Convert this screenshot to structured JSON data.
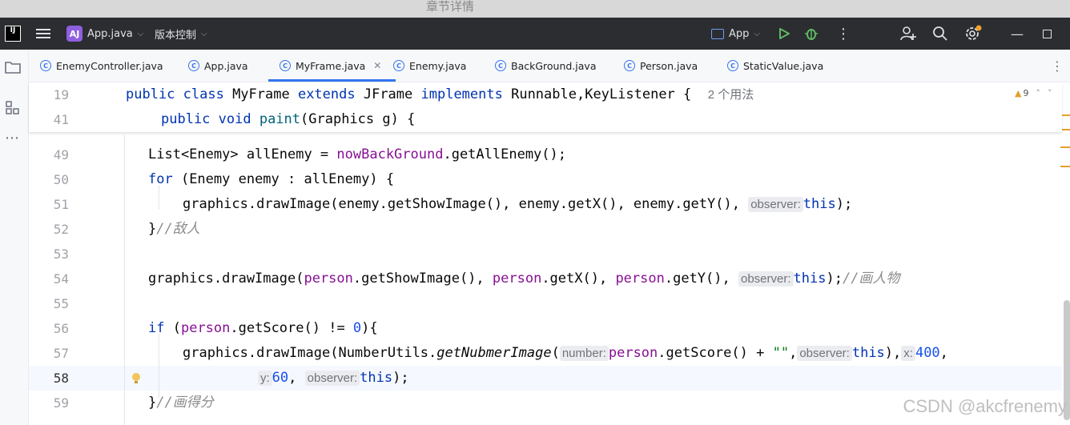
{
  "window": {
    "title": "章节详情"
  },
  "toolbar": {
    "project_badge": "AJ",
    "project_name": "App.java",
    "vcs_label": "版本控制",
    "run_config": "App"
  },
  "tabs": [
    {
      "label": "EnemyController.java",
      "active": false
    },
    {
      "label": "App.java",
      "active": false
    },
    {
      "label": "MyFrame.java",
      "active": true
    },
    {
      "label": "Enemy.java",
      "active": false
    },
    {
      "label": "BackGround.java",
      "active": false
    },
    {
      "label": "Person.java",
      "active": false
    },
    {
      "label": "StaticValue.java",
      "active": false
    }
  ],
  "inspection": {
    "warnings": "9"
  },
  "editor": {
    "sticky": [
      {
        "num": "19",
        "a": "public class ",
        "b": "MyFrame ",
        "c": "extends ",
        "d": "JFrame ",
        "e": "implements ",
        "f": "Runnable,KeyListener {",
        "hint": "2 个用法"
      },
      {
        "num": "41",
        "a": "public void ",
        "b": "paint",
        "c": "(Graphics g) {"
      }
    ],
    "lines": [
      {
        "num": "49"
      },
      {
        "num": "50"
      },
      {
        "num": "51"
      },
      {
        "num": "52"
      },
      {
        "num": "53"
      },
      {
        "num": "54"
      },
      {
        "num": "55"
      },
      {
        "num": "56"
      },
      {
        "num": "57"
      },
      {
        "num": "58"
      },
      {
        "num": "59"
      }
    ],
    "l49": {
      "a": "List<Enemy> allEnemy = ",
      "b": "nowBackGround",
      "c": ".getAllEnemy();"
    },
    "l50": {
      "a": "for ",
      "b": "(Enemy enemy : allEnemy) {"
    },
    "l51": {
      "a": "graphics.drawImage(enemy.getShowImage(), enemy.getX(), enemy.getY(), ",
      "hint": "observer:",
      "b": "this",
      "c": ");"
    },
    "l52": {
      "a": "}",
      "b": "//敌人"
    },
    "l54": {
      "a": "graphics.drawImage(",
      "b": "person",
      "c": ".getShowImage(), ",
      "d": "person",
      "e": ".getX(), ",
      "f": "person",
      "g": ".getY(), ",
      "hint": "observer:",
      "h": "this",
      "i": ");",
      "j": "//画人物"
    },
    "l56": {
      "a": "if ",
      "b": "(",
      "c": "person",
      "d": ".getScore() != ",
      "e": "0",
      "f": "){"
    },
    "l57": {
      "a": "graphics.drawImage(NumberUtils.",
      "b": "getNubmerImage",
      "c": "(",
      "hint1": "number:",
      "d": "person",
      "e": ".getScore() + ",
      "f": "\"\"",
      "g": ",",
      "hint2": "observer:",
      "h": "this",
      "i": "),",
      "hint3": "x:",
      "j": "400",
      "k": ","
    },
    "l58": {
      "hint1": "y:",
      "a": "60",
      "b": ", ",
      "hint2": "observer:",
      "c": "this",
      "d": ");"
    },
    "l59": {
      "a": "}",
      "b": "//画得分"
    }
  },
  "watermark": "CSDN @akcfrenemy",
  "colors": {
    "toolbar": "#2b2d30",
    "accent": "#3574f0",
    "keyword": "#0033b3",
    "field": "#871094",
    "number": "#1750eb"
  }
}
